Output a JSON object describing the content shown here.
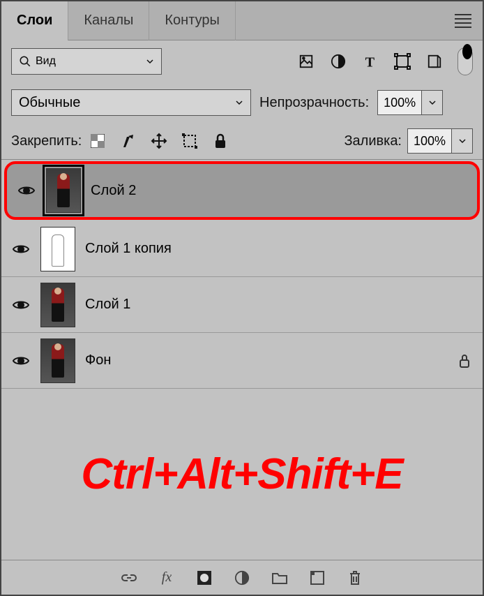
{
  "tabs": [
    "Слои",
    "Каналы",
    "Контуры"
  ],
  "activeTab": 0,
  "filterLabel": "Вид",
  "blendMode": "Обычные",
  "opacityLabel": "Непрозрачность:",
  "opacityValue": "100%",
  "lockLabel": "Закрепить:",
  "fillLabel": "Заливка:",
  "fillValue": "100%",
  "layers": [
    {
      "name": "Слой 2",
      "selected": true,
      "visible": true,
      "locked": false,
      "thumb": "person"
    },
    {
      "name": "Слой 1 копия",
      "selected": false,
      "visible": true,
      "locked": false,
      "thumb": "sketch"
    },
    {
      "name": "Слой 1",
      "selected": false,
      "visible": true,
      "locked": false,
      "thumb": "person"
    },
    {
      "name": "Фон",
      "selected": false,
      "visible": true,
      "locked": true,
      "thumb": "person"
    }
  ],
  "overlayText": "Ctrl+Alt+Shift+E"
}
